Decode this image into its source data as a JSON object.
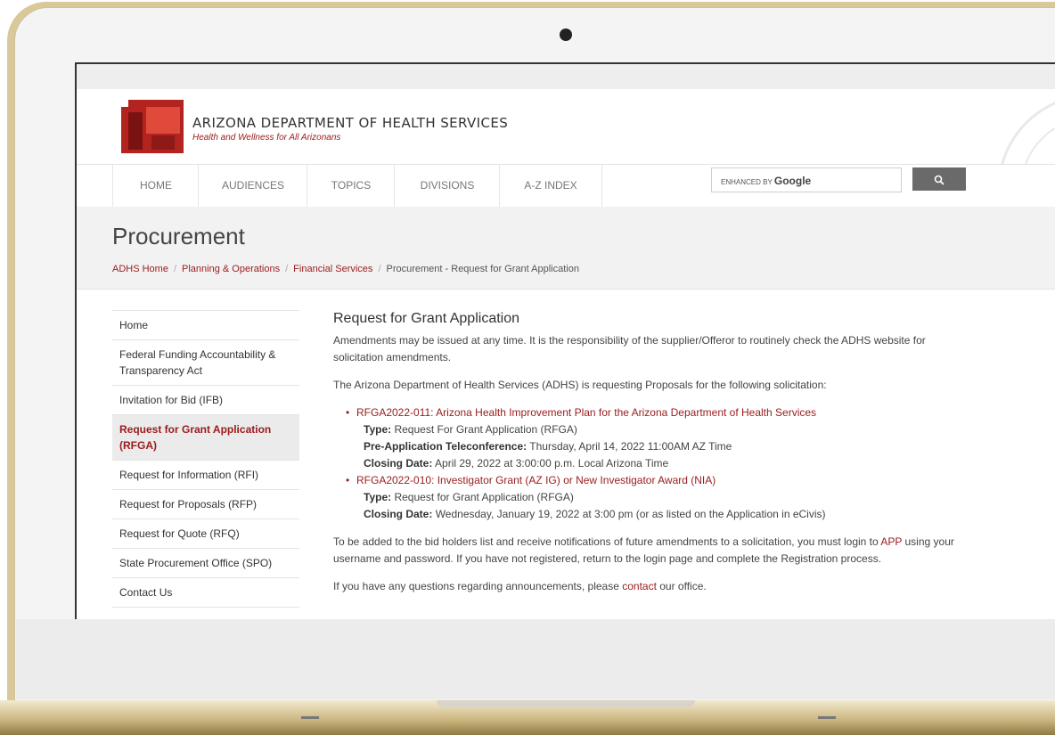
{
  "header": {
    "org_title": "ARIZONA DEPARTMENT OF HEALTH SERVICES",
    "tagline": "Health and Wellness for All Arizonans"
  },
  "nav": {
    "items": [
      "HOME",
      "AUDIENCES",
      "TOPICS",
      "DIVISIONS",
      "A-Z INDEX"
    ]
  },
  "search": {
    "brand_prefix": "ENHANCED BY",
    "brand_name": "Google",
    "button_icon": "search-icon"
  },
  "page": {
    "title": "Procurement",
    "breadcrumb": [
      "ADHS Home",
      "Planning & Operations",
      "Financial Services",
      "Procurement - Request for Grant Application"
    ]
  },
  "sidebar": {
    "items": [
      {
        "label": "Home"
      },
      {
        "label": "Federal Funding Accountability & Transparency Act"
      },
      {
        "label": "Invitation for Bid (IFB)"
      },
      {
        "label": "Request for Grant Application (RFGA)"
      },
      {
        "label": "Request for Information (RFI)"
      },
      {
        "label": "Request for Proposals (RFP)"
      },
      {
        "label": "Request for Quote (RFQ)"
      },
      {
        "label": "State Procurement Office (SPO)"
      },
      {
        "label": "Contact Us"
      }
    ],
    "active_index": 3
  },
  "main": {
    "heading": "Request for Grant Application",
    "intro": "Amendments may be issued at any time. It is the responsibility of the supplier/Offeror to routinely check the ADHS website for solicitation amendments.",
    "lead": "The Arizona Department of Health Services (ADHS) is requesting Proposals for the following solicitation:",
    "solicitations": [
      {
        "title": "RFGA2022-011: Arizona Health Improvement Plan for the Arizona Department of Health Services",
        "type_label": "Type:",
        "type_value": "Request For Grant Application (RFGA)",
        "extra_label": "Pre-Application Teleconference:",
        "extra_value": "Thursday, April 14, 2022 11:00AM AZ Time",
        "closing_label": "Closing Date:",
        "closing_value": "April 29, 2022 at 3:00:00 p.m. Local Arizona Time"
      },
      {
        "title": "RFGA2022-010: Investigator Grant (AZ IG) or New Investigator Award (NIA)",
        "type_label": "Type:",
        "type_value": "Request for Grant Application (RFGA)",
        "closing_label": "Closing Date:",
        "closing_value": "Wednesday, January 19, 2022 at 3:00 pm (or as listed on the Application in eCivis)"
      }
    ],
    "bidders_before": "To be added to the bid holders list and receive notifications of future amendments to a solicitation, you must login to ",
    "bidders_link": "APP",
    "bidders_after": " using your username and password. If you have not registered, return to the login page and complete the Registration process.",
    "questions_before": "If you have any questions regarding announcements, please ",
    "questions_link": "contact",
    "questions_after": " our office."
  },
  "colors": {
    "accent": "#9b1b1b",
    "nav_text": "#777777",
    "band": "#f2f2f2"
  }
}
